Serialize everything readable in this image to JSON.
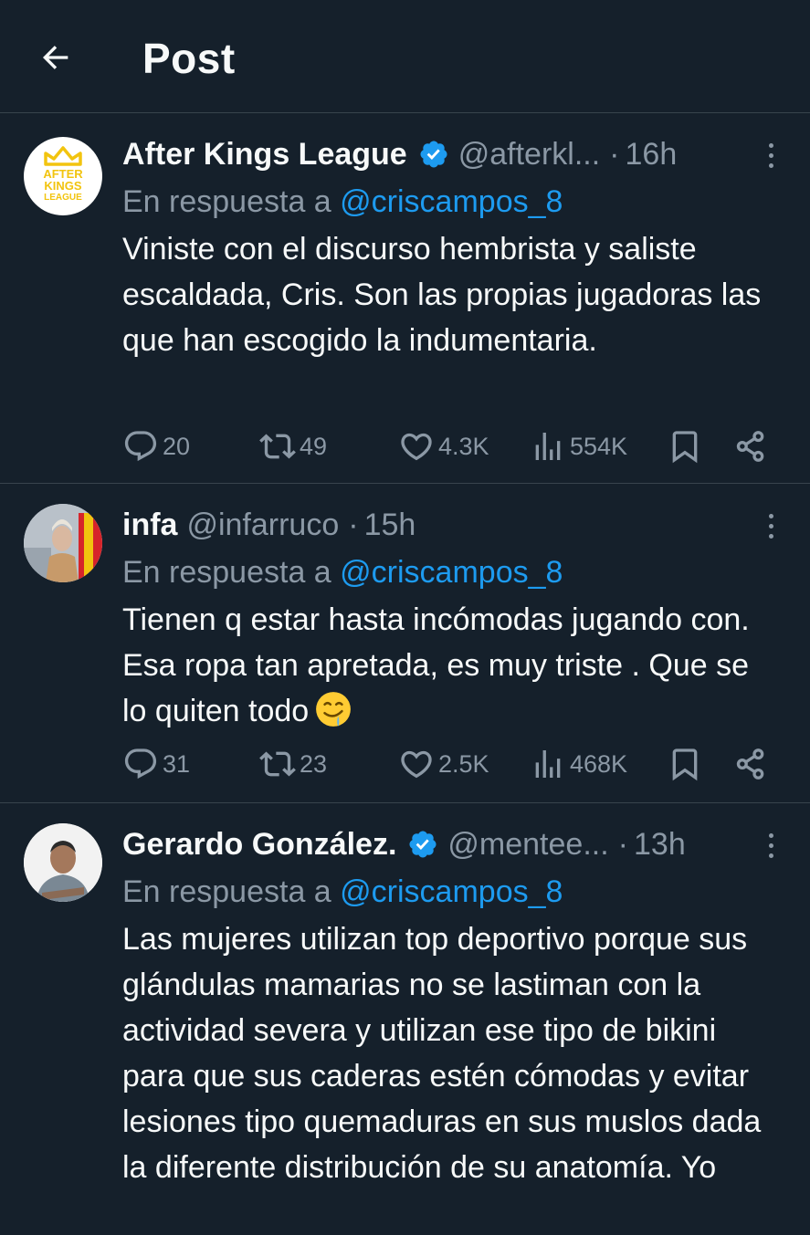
{
  "header": {
    "title": "Post"
  },
  "reply_prefix": "En respuesta a",
  "tweets": [
    {
      "display_name": "After Kings League",
      "verified": true,
      "handle": "@afterkl...",
      "separator": "·",
      "time": "16h",
      "reply_to": "@criscampos_8",
      "text": "Viniste con el discurso hembrista y saliste escaldada, Cris. Son las propias jugadoras las que han escogido la indumentaria.",
      "avatar_logo": [
        "AFTER",
        "KINGS",
        "LEAGUE"
      ],
      "stats": {
        "replies": "20",
        "reposts": "49",
        "likes": "4.3K",
        "views": "554K"
      }
    },
    {
      "display_name": "infa",
      "verified": false,
      "handle": "@infarruco",
      "separator": "·",
      "time": "15h",
      "reply_to": "@criscampos_8",
      "text": "Tienen q estar hasta incómodas jugando con. Esa ropa tan apretada, es muy triste  . Que se lo quiten todo",
      "emoji": "drooling-face",
      "stats": {
        "replies": "31",
        "reposts": "23",
        "likes": "2.5K",
        "views": "468K"
      }
    },
    {
      "display_name": "Gerardo González.",
      "verified": true,
      "handle": "@mentee...",
      "separator": "·",
      "time": "13h",
      "reply_to": "@criscampos_8",
      "text": "Las mujeres utilizan top deportivo porque sus glándulas mamarias no se lastiman con la actividad severa y utilizan ese tipo de bikini para que sus caderas estén cómodas y evitar lesiones tipo quemaduras en sus muslos dada la diferente distribución de su anatomía. Yo"
    }
  ],
  "colors": {
    "background": "#15202b",
    "text": "#f7f9f9",
    "muted": "#8b98a5",
    "link": "#1d9bf0",
    "divider": "#38444d",
    "logo_yellow": "#f2c40f"
  },
  "icons": [
    "back-arrow-icon",
    "verified-badge-icon",
    "more-icon",
    "reply-icon",
    "repost-icon",
    "like-icon",
    "views-icon",
    "bookmark-icon",
    "share-icon"
  ]
}
